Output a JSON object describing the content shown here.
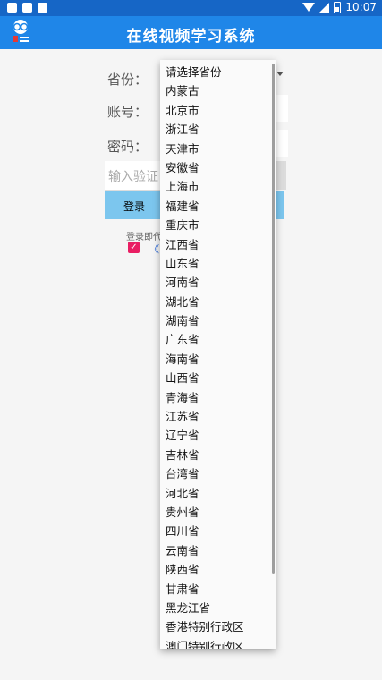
{
  "status_bar": {
    "time": "10:07"
  },
  "app_bar": {
    "title": "在线视频学习系统"
  },
  "form": {
    "province_label": "省份：",
    "account_label": "账号：",
    "password_label": "密码：",
    "code_placeholder": "输入验证",
    "login_button": "登录",
    "agreement_text": "登录即代",
    "policy_link": "《",
    "agree_checked": true
  },
  "dropdown": {
    "options": [
      "请选择省份",
      "内蒙古",
      "北京市",
      "浙江省",
      "天津市",
      "安徽省",
      "上海市",
      "福建省",
      "重庆市",
      "江西省",
      "山东省",
      "河南省",
      "湖北省",
      "湖南省",
      "广东省",
      "海南省",
      "山西省",
      "青海省",
      "江苏省",
      "辽宁省",
      "吉林省",
      "台湾省",
      "河北省",
      "贵州省",
      "四川省",
      "云南省",
      "陕西省",
      "甘肃省",
      "黑龙江省",
      "香港特别行政区",
      "澳门特别行政区"
    ]
  },
  "colors": {
    "status_bar": "#1666c6",
    "app_bar": "#1f86e8",
    "login_button": "#7cc6ee",
    "checkbox": "#e91e63"
  }
}
